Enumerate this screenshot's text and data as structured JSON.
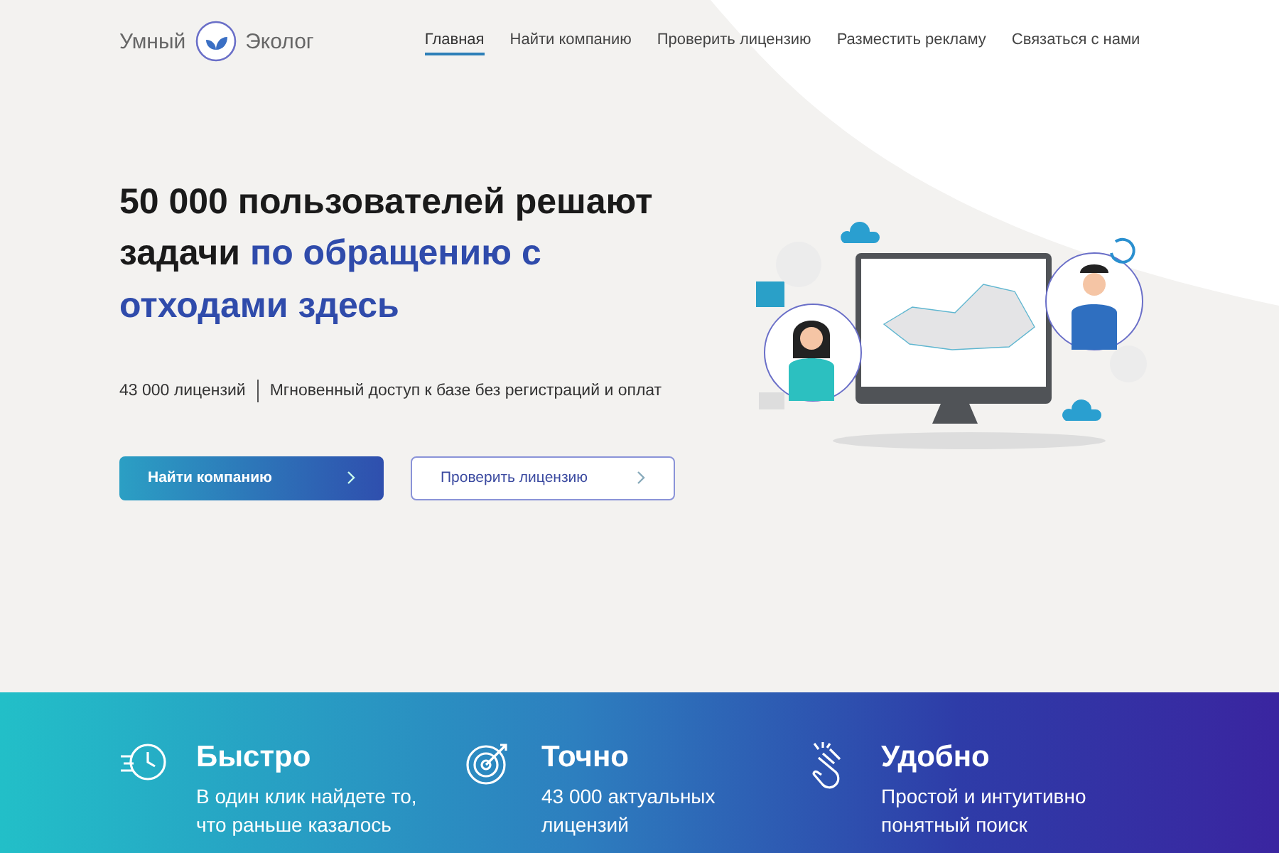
{
  "header": {
    "logo": {
      "left": "Умный",
      "right": "Эколог"
    },
    "nav": [
      {
        "label": "Главная",
        "selected": true
      },
      {
        "label": "Найти компанию",
        "selected": false
      },
      {
        "label": "Проверить лицензию",
        "selected": false
      },
      {
        "label": "Разместить рекламу",
        "selected": false
      },
      {
        "label": "Связаться с нами",
        "selected": false
      }
    ]
  },
  "hero": {
    "title": "50 000 пользователей решают задачи **по обращению с отходами здесь**",
    "stat": "43 000 лицензий",
    "tagline": "Мгновенный доступ к базе без регистраций и оплат",
    "buttons": [
      {
        "label": "Найти компанию",
        "kind": "primary"
      },
      {
        "label": "Проверить лицензию",
        "kind": "outline"
      }
    ]
  },
  "features": [
    {
      "title": "Быстро",
      "text": "В один клик найдете то, что раньше казалось",
      "kind": "clock"
    },
    {
      "title": "Точно",
      "text": "43 000 актуальных лицензий",
      "kind": "target"
    },
    {
      "title": "Удобно",
      "text": "Простой и интуитивно понятный поиск",
      "kind": "hand"
    }
  ]
}
